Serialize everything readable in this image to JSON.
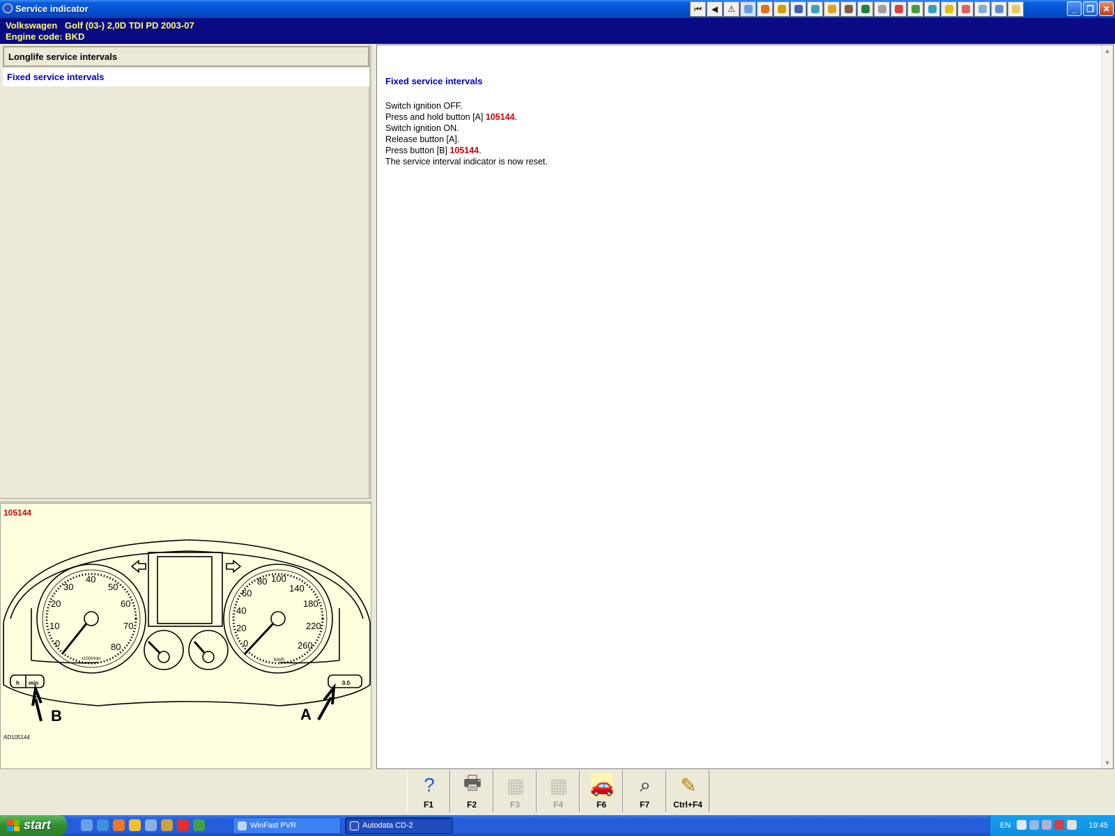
{
  "window": {
    "title": "Service indicator",
    "toolbar_icons": [
      "first-page-icon",
      "previous-icon",
      "warning-icon",
      "map-icon",
      "clock-icon",
      "tool-icon",
      "gauge-icon",
      "engine-icon",
      "fuel-icon",
      "diagram-icon",
      "belt-icon",
      "battery-icon",
      "car-icon",
      "parts-icon",
      "repair-icon",
      "lamp-icon",
      "info-icon",
      "sign-icon",
      "car-side-icon",
      "note-icon"
    ],
    "controls": {
      "minimize": "_",
      "restore": "❐",
      "close": "✕"
    }
  },
  "vehicle": {
    "line1": "Volkswagen   Golf (03-) 2,0D TDI PD 2003-07",
    "line2": "Engine code: BKD"
  },
  "nav": {
    "items": [
      {
        "label": "Longlife service intervals"
      },
      {
        "label": "Fixed service intervals"
      }
    ]
  },
  "diagram": {
    "ref": "105144",
    "code": "AD105144",
    "label_a": "A",
    "label_b": "B",
    "speedo_ticks": [
      "0",
      "20",
      "40",
      "60",
      "80",
      "100",
      "140",
      "180",
      "220",
      "260"
    ],
    "speedo_unit": "km/h",
    "tacho_ticks": [
      "0",
      "10",
      "20",
      "30",
      "40",
      "50",
      "60",
      "70",
      "80"
    ],
    "tacho_unit": "x1000/min",
    "button_b_label": "min",
    "button_h_label": "h",
    "button_a_label": "0.0"
  },
  "content": {
    "title": "Fixed service intervals",
    "steps": [
      {
        "text": "Switch ignition OFF.",
        "ref": "",
        "suffix": ""
      },
      {
        "text": "Press and hold button [A] ",
        "ref": "105144",
        "suffix": "."
      },
      {
        "text": "Switch ignition ON.",
        "ref": "",
        "suffix": ""
      },
      {
        "text": "Release button [A].",
        "ref": "",
        "suffix": ""
      },
      {
        "text": "Press button [B] ",
        "ref": "105144",
        "suffix": "."
      },
      {
        "text": "The service interval indicator is now reset.",
        "ref": "",
        "suffix": ""
      }
    ]
  },
  "function_keys": [
    {
      "label": "F1",
      "icon": "help-icon",
      "glyph": "?",
      "enabled": true
    },
    {
      "label": "F2",
      "icon": "print-icon",
      "glyph": "🖶",
      "enabled": true
    },
    {
      "label": "F3",
      "icon": "image-print-icon",
      "glyph": "▦",
      "enabled": false
    },
    {
      "label": "F4",
      "icon": "image-copy-icon",
      "glyph": "▦",
      "enabled": false
    },
    {
      "label": "F6",
      "icon": "vehicle-data-icon",
      "glyph": "🚗",
      "enabled": true
    },
    {
      "label": "F7",
      "icon": "zoom-icon",
      "glyph": "⌕",
      "enabled": true
    },
    {
      "label": "Ctrl+F4",
      "icon": "notes-icon",
      "glyph": "✎",
      "enabled": true
    }
  ],
  "taskbar": {
    "start_label": "start",
    "tasks": [
      {
        "label": "WinFast PVR"
      },
      {
        "label": "Autodata CD-2"
      }
    ],
    "tray": {
      "lang": "EN",
      "clock": "19:45"
    }
  }
}
